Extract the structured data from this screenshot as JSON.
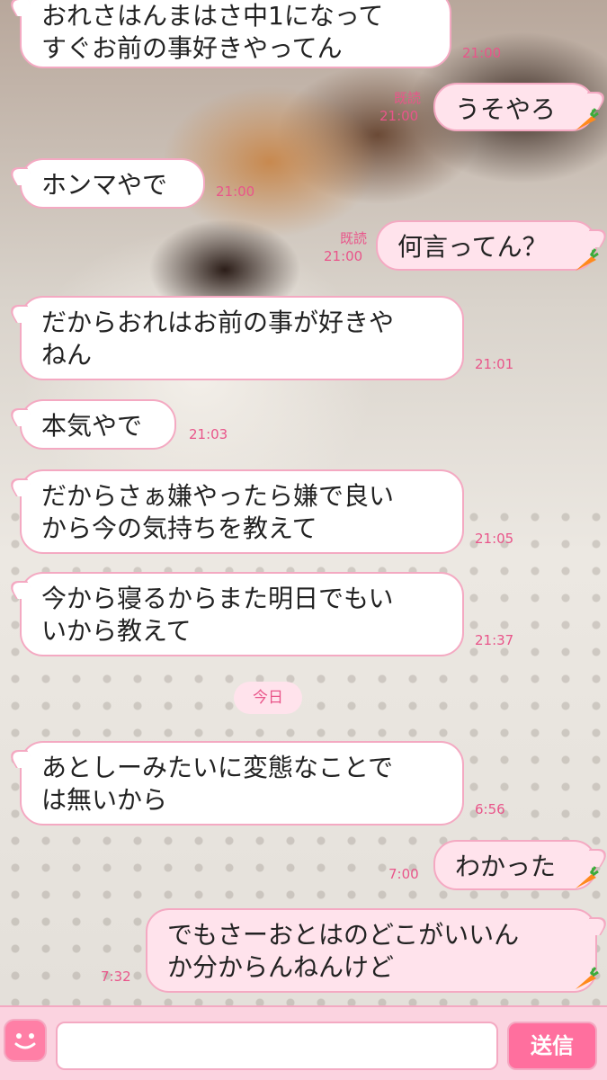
{
  "messages": [
    {
      "side": "in",
      "text": "おれさはんまはさ中1になって\nすぐお前の事好きやってん",
      "time": "21:00"
    },
    {
      "side": "out",
      "text": "うそやろ",
      "time": "21:00",
      "read": "既読"
    },
    {
      "side": "in",
      "text": "ホンマやで",
      "time": "21:00"
    },
    {
      "side": "out",
      "text": "何言ってん？",
      "time": "21:00",
      "read": "既読"
    },
    {
      "side": "in",
      "text": "だからおれはお前の事が好きや\nねん",
      "time": "21:01"
    },
    {
      "side": "in",
      "text": "本気やで",
      "time": "21:03"
    },
    {
      "side": "in",
      "text": "だからさぁ嫌やったら嫌で良い\nから今の気持ちを教えて",
      "time": "21:05"
    },
    {
      "side": "in",
      "text": "今から寝るからまた明日でもい\nいから教えて",
      "time": "21:37"
    },
    {
      "side": "in",
      "text": "あとしーみたいに変態なことで\nは無いから",
      "time": "6:56"
    },
    {
      "side": "out",
      "text": "わかった",
      "time": "7:00"
    },
    {
      "side": "out",
      "text": "でもさーおとはのどこがいいん\nか分からんねんけど",
      "time": "7:32"
    }
  ],
  "day_separator": "今日",
  "composer": {
    "placeholder": "",
    "send_label": "送信"
  },
  "icons": {
    "sticker": "smiley-face-icon",
    "mark": "carrot-icon"
  }
}
